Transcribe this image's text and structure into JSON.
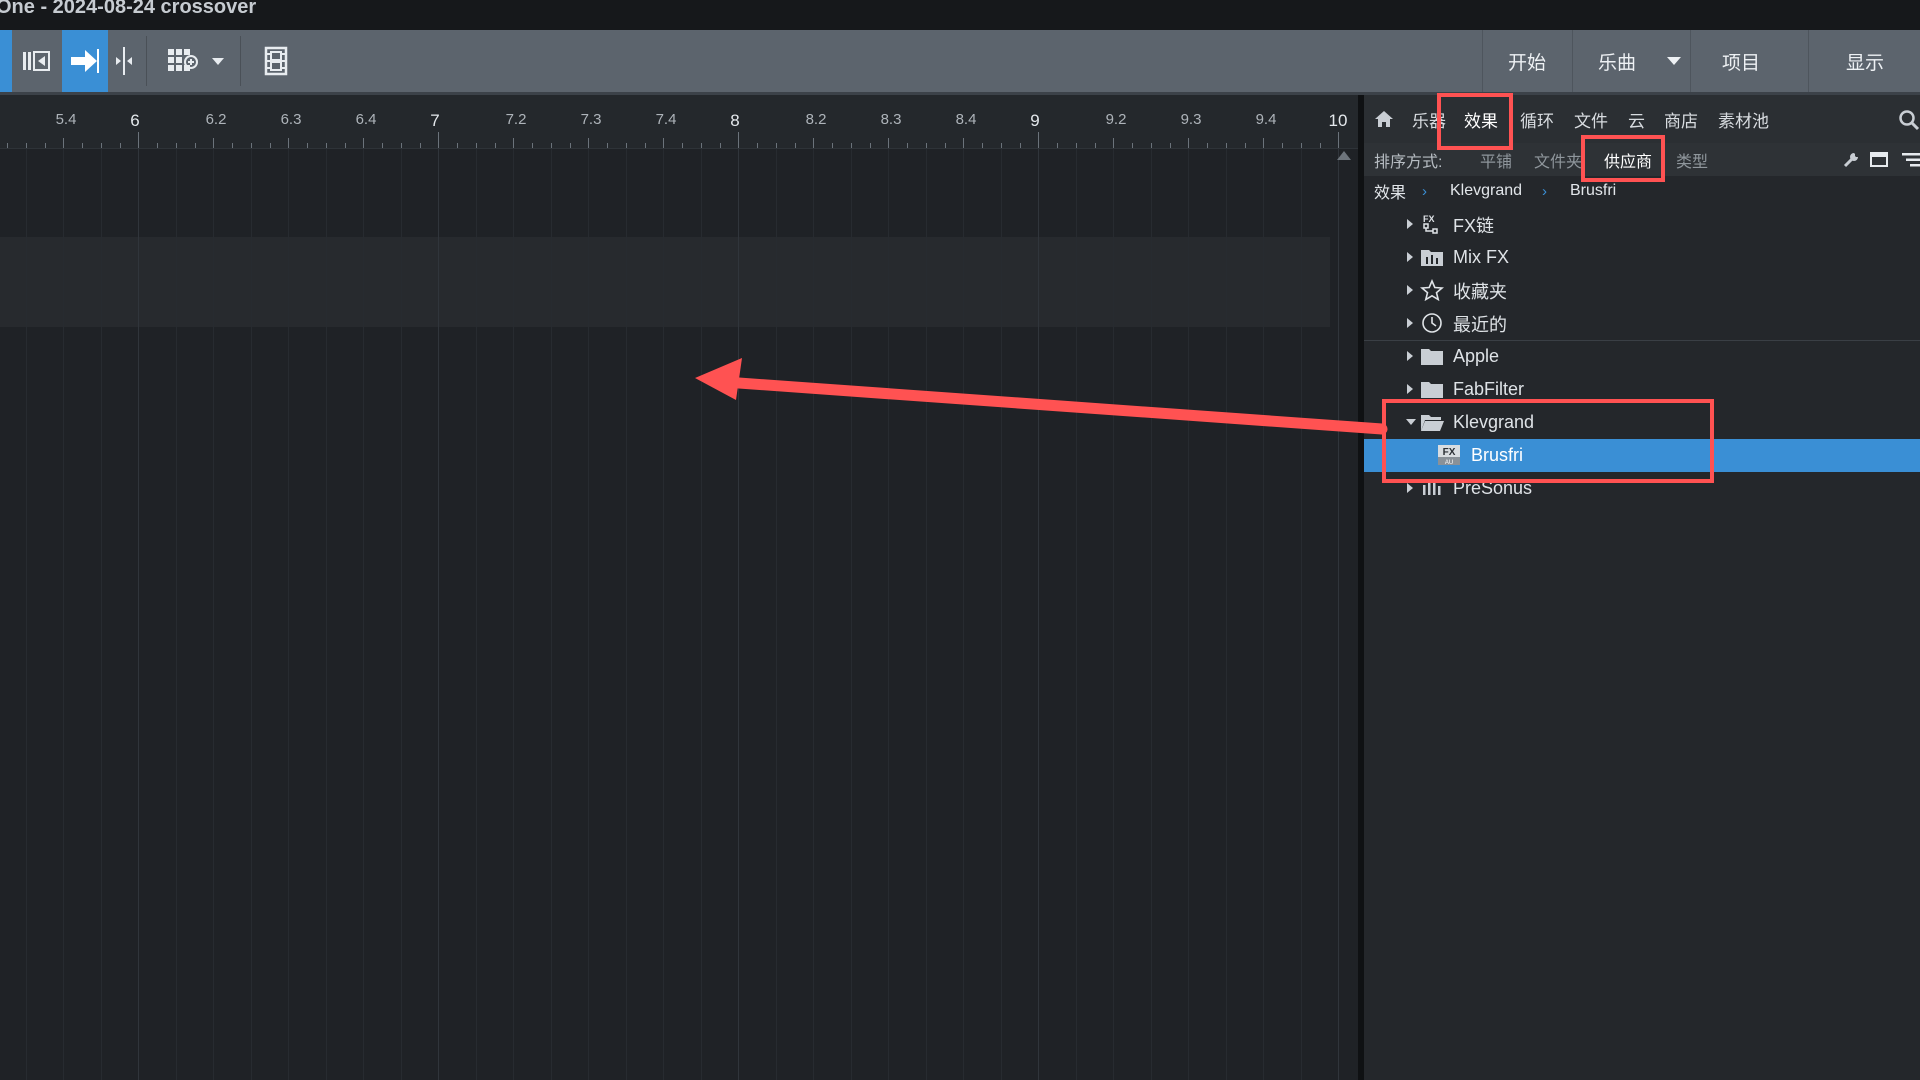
{
  "window": {
    "title": "One - 2024-08-24 crossover"
  },
  "toolbar": {
    "start": "开始",
    "song": "乐曲",
    "project": "项目",
    "show": "显示"
  },
  "ruler": {
    "labels": [
      "5.4",
      "6",
      "6.2",
      "6.3",
      "6.4",
      "7",
      "7.2",
      "7.3",
      "7.4",
      "8",
      "8.2",
      "8.3",
      "8.4",
      "9",
      "9.2",
      "9.3",
      "9.4",
      "10"
    ]
  },
  "browser": {
    "tabs": [
      "乐器",
      "效果",
      "循环",
      "文件",
      "云",
      "商店",
      "素材池"
    ],
    "active_tab": "效果",
    "sort": {
      "label": "排序方式:",
      "options": [
        "平铺",
        "文件夹",
        "供应商",
        "类型"
      ],
      "active": "供应商"
    },
    "breadcrumb": [
      "效果",
      "Klevgrand",
      "Brusfri"
    ],
    "tree": [
      {
        "label": "FX链",
        "icon": "fx-chain-icon",
        "expanded": false
      },
      {
        "label": "Mix FX",
        "icon": "mix-fx-icon",
        "expanded": false
      },
      {
        "label": "收藏夹",
        "icon": "star-icon",
        "expanded": false
      },
      {
        "label": "最近的",
        "icon": "clock-icon",
        "expanded": false
      },
      {
        "label": "Apple",
        "icon": "folder-icon",
        "expanded": false
      },
      {
        "label": "FabFilter",
        "icon": "folder-icon",
        "expanded": false
      },
      {
        "label": "Klevgrand",
        "icon": "folder-open-icon",
        "expanded": true
      },
      {
        "label": "Brusfri",
        "icon": "fx-plugin-icon",
        "selected": true
      },
      {
        "label": "PreSonus",
        "icon": "presonus-icon",
        "expanded": false
      }
    ],
    "fx_badge": "FX",
    "au_badge": "AU"
  },
  "colors": {
    "accent": "#3a8fd5",
    "annotation": "#ff5252",
    "toolbar": "#5c646d",
    "background": "#1f2226"
  }
}
